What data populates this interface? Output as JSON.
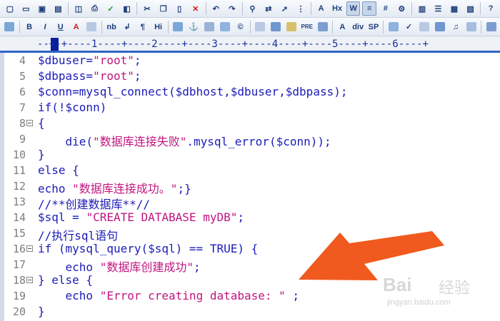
{
  "toolbar_top": {
    "icons": [
      "new-file-icon",
      "open-folder-icon",
      "save-icon",
      "save-all-icon",
      "separator",
      "print-preview-icon",
      "print-icon",
      "spellcheck-icon",
      "html-validate-icon",
      "separator",
      "cut-icon",
      "copy-icon",
      "paste-icon",
      "delete-icon",
      "separator",
      "undo-icon",
      "redo-icon",
      "separator",
      "find-icon",
      "replace-icon",
      "goto-icon",
      "insert-column-icon",
      "separator",
      "font-size-icon",
      "hex-mode-icon",
      "word-wrap-icon",
      "column-mode-icon",
      "line-numbers-icon",
      "settings-icon",
      "separator",
      "view-icon",
      "list-icon",
      "window-icon",
      "window2-icon",
      "separator",
      "help-icon"
    ],
    "labels": {
      "hex": "Hx"
    }
  },
  "toolbar_format": {
    "items": [
      {
        "name": "browser-icon",
        "label": ""
      },
      {
        "name": "bold-button",
        "label": "B"
      },
      {
        "name": "italic-button",
        "label": "I"
      },
      {
        "name": "underline-button",
        "label": "U"
      },
      {
        "name": "font-color-icon",
        "label": "A"
      },
      {
        "name": "color-picker-icon",
        "label": ""
      },
      {
        "name": "nbsp-button",
        "label": "nb"
      },
      {
        "name": "line-break-icon",
        "label": "↲"
      },
      {
        "name": "paragraph-icon",
        "label": "¶"
      },
      {
        "name": "heading-button",
        "label": "Hi"
      },
      {
        "name": "image-icon",
        "label": ""
      },
      {
        "name": "anchor-icon",
        "label": "⚓"
      },
      {
        "name": "horizontal-rule-icon",
        "label": ""
      },
      {
        "name": "comment-icon",
        "label": ""
      },
      {
        "name": "copyright-icon",
        "label": "©"
      },
      {
        "name": "table-icon",
        "label": ""
      },
      {
        "name": "frame-icon",
        "label": ""
      },
      {
        "name": "center-icon",
        "label": ""
      },
      {
        "name": "pre-button",
        "label": "PRE"
      },
      {
        "name": "list-icon",
        "label": ""
      },
      {
        "name": "font-icon",
        "label": "A"
      },
      {
        "name": "div-button",
        "label": "div"
      },
      {
        "name": "span-button",
        "label": "SP"
      },
      {
        "name": "edit-icon",
        "label": ""
      },
      {
        "name": "check-icon",
        "label": "✓"
      },
      {
        "name": "media-icon",
        "label": ""
      },
      {
        "name": "video-icon",
        "label": ""
      },
      {
        "name": "music-icon",
        "label": "♫"
      },
      {
        "name": "form-icon",
        "label": ""
      },
      {
        "name": "panel-icon",
        "label": ""
      }
    ]
  },
  "ruler": {
    "text": "--+-+----1----+----2----+----3----+----4----+----5----+----6----+"
  },
  "code_lines": [
    {
      "num": "4",
      "fold": false,
      "segments": [
        {
          "t": "$dbuser=",
          "k": "code"
        },
        {
          "t": "\"root\"",
          "k": "str"
        },
        {
          "t": ";",
          "k": "code"
        }
      ]
    },
    {
      "num": "5",
      "fold": false,
      "segments": [
        {
          "t": "$dbpass=",
          "k": "code"
        },
        {
          "t": "\"root\"",
          "k": "str"
        },
        {
          "t": ";",
          "k": "code"
        }
      ]
    },
    {
      "num": "6",
      "fold": false,
      "segments": [
        {
          "t": "$conn=mysql_connect($dbhost,$dbuser,$dbpass);",
          "k": "code"
        }
      ]
    },
    {
      "num": "7",
      "fold": false,
      "segments": [
        {
          "t": "if(!$conn)",
          "k": "code"
        }
      ]
    },
    {
      "num": "8",
      "fold": true,
      "segments": [
        {
          "t": "{",
          "k": "code"
        }
      ]
    },
    {
      "num": "9",
      "fold": false,
      "segments": [
        {
          "t": "    die(",
          "k": "code"
        },
        {
          "t": "\"数据库连接失败\"",
          "k": "str"
        },
        {
          "t": ".mysql_error($conn));",
          "k": "code"
        }
      ]
    },
    {
      "num": "10",
      "fold": false,
      "segments": [
        {
          "t": "}",
          "k": "code"
        }
      ]
    },
    {
      "num": "11",
      "fold": false,
      "segments": [
        {
          "t": "else {",
          "k": "code"
        }
      ]
    },
    {
      "num": "12",
      "fold": false,
      "segments": [
        {
          "t": "echo ",
          "k": "code"
        },
        {
          "t": "\"数据库连接成功。\"",
          "k": "str"
        },
        {
          "t": ";}",
          "k": "code"
        }
      ]
    },
    {
      "num": "13",
      "fold": false,
      "segments": [
        {
          "t": "//**创建数据库**//",
          "k": "code"
        }
      ]
    },
    {
      "num": "14",
      "fold": false,
      "segments": [
        {
          "t": "$sql = ",
          "k": "code"
        },
        {
          "t": "\"CREATE DATABASE myDB\"",
          "k": "str"
        },
        {
          "t": ";",
          "k": "code"
        }
      ]
    },
    {
      "num": "15",
      "fold": false,
      "segments": [
        {
          "t": "//执行sql语句",
          "k": "code"
        }
      ]
    },
    {
      "num": "16",
      "fold": true,
      "segments": [
        {
          "t": "if (mysql_query($sql) == TRUE) {",
          "k": "code"
        }
      ]
    },
    {
      "num": "17",
      "fold": false,
      "segments": [
        {
          "t": "    echo ",
          "k": "code"
        },
        {
          "t": "\"数据库创建成功\"",
          "k": "str"
        },
        {
          "t": ";",
          "k": "code"
        }
      ]
    },
    {
      "num": "18",
      "fold": true,
      "segments": [
        {
          "t": "} else {",
          "k": "code"
        }
      ]
    },
    {
      "num": "19",
      "fold": false,
      "segments": [
        {
          "t": "    echo ",
          "k": "code"
        },
        {
          "t": "\"Error creating database: \"",
          "k": "str"
        },
        {
          "t": " ;",
          "k": "code"
        }
      ]
    },
    {
      "num": "20",
      "fold": false,
      "segments": [
        {
          "t": "}",
          "k": "code"
        }
      ]
    }
  ],
  "annotation": {
    "color": "#f05a1e"
  },
  "watermark": {
    "logo": "Bai经验",
    "url": "jingyan.baidu.com"
  },
  "colors": {
    "code": "#1b1bb8",
    "string": "#c1157f",
    "line_number": "#7d7d7d",
    "ruler_text": "#1a2fa0"
  }
}
